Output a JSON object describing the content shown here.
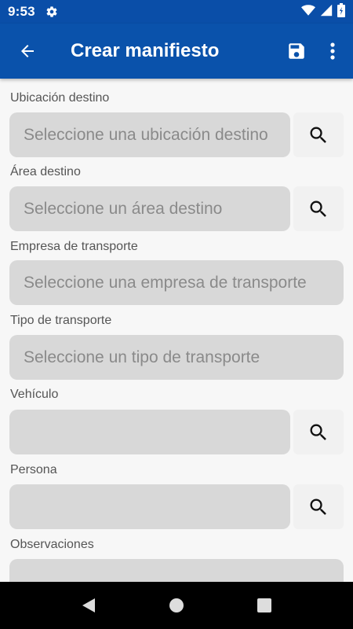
{
  "status_bar": {
    "time": "9:53"
  },
  "app_bar": {
    "title": "Crear manifiesto"
  },
  "form": {
    "fields": [
      {
        "label": "Ubicación destino",
        "placeholder": "Seleccione una ubicación destino"
      },
      {
        "label": "Área destino",
        "placeholder": "Seleccione un área destino"
      },
      {
        "label": "Empresa de transporte",
        "placeholder": "Seleccione una empresa de transporte"
      },
      {
        "label": "Tipo de transporte",
        "placeholder": "Seleccione un tipo de transporte"
      },
      {
        "label": "Vehículo",
        "placeholder": ""
      },
      {
        "label": "Persona",
        "placeholder": ""
      },
      {
        "label": "Observaciones",
        "placeholder": ""
      }
    ]
  },
  "colors": {
    "primary": "#0a52ab",
    "status_bar": "#0a4ea8",
    "input_bg": "#d8d8d8",
    "placeholder": "#8a8a8a"
  },
  "icons": [
    "settings-icon",
    "wifi-icon",
    "signal-icon",
    "battery-icon",
    "arrow-back-icon",
    "save-icon",
    "more-vert-icon",
    "search-icon",
    "nav-back-icon",
    "nav-home-icon",
    "nav-recents-icon"
  ]
}
